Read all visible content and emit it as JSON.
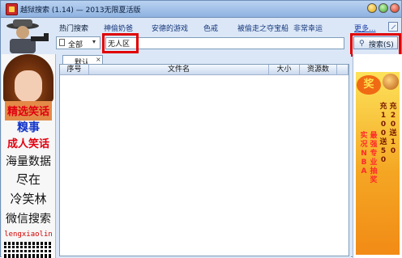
{
  "window": {
    "title": "越狱搜索 (1.14) — 2013无限夏活版",
    "buttons": {
      "minimize": "minimize",
      "maximize": "maximize",
      "close": "close"
    }
  },
  "hotbar": {
    "label": "热门搜索",
    "links": [
      "神偷奶爸",
      "安德的游戏",
      "色戒",
      "被偷走之夺宝船",
      "非常幸运"
    ],
    "more": "更多..."
  },
  "search": {
    "scope": "全部",
    "query": "无人区",
    "button_label": "搜索(S)"
  },
  "tabs": [
    {
      "label": "默认",
      "close": "×"
    }
  ],
  "results": {
    "columns": [
      "序号",
      "文件名",
      "大小",
      "资源数"
    ],
    "rows": []
  },
  "left_ad": {
    "lines": [
      "精选笑话",
      "糗事",
      "成人笑话",
      "海量数据",
      "尽在",
      "冷笑林",
      "微信搜索",
      "lengxiaolin"
    ]
  },
  "right_ad": {
    "badge": "奖",
    "col_a": "实况NBA",
    "col_b": "最强专业抽奖",
    "col_c": "充100送50",
    "col_d": "充20送10"
  },
  "colors": {
    "accent": "#6f8fb8",
    "highlight": "#e00000",
    "link": "#13357a"
  }
}
